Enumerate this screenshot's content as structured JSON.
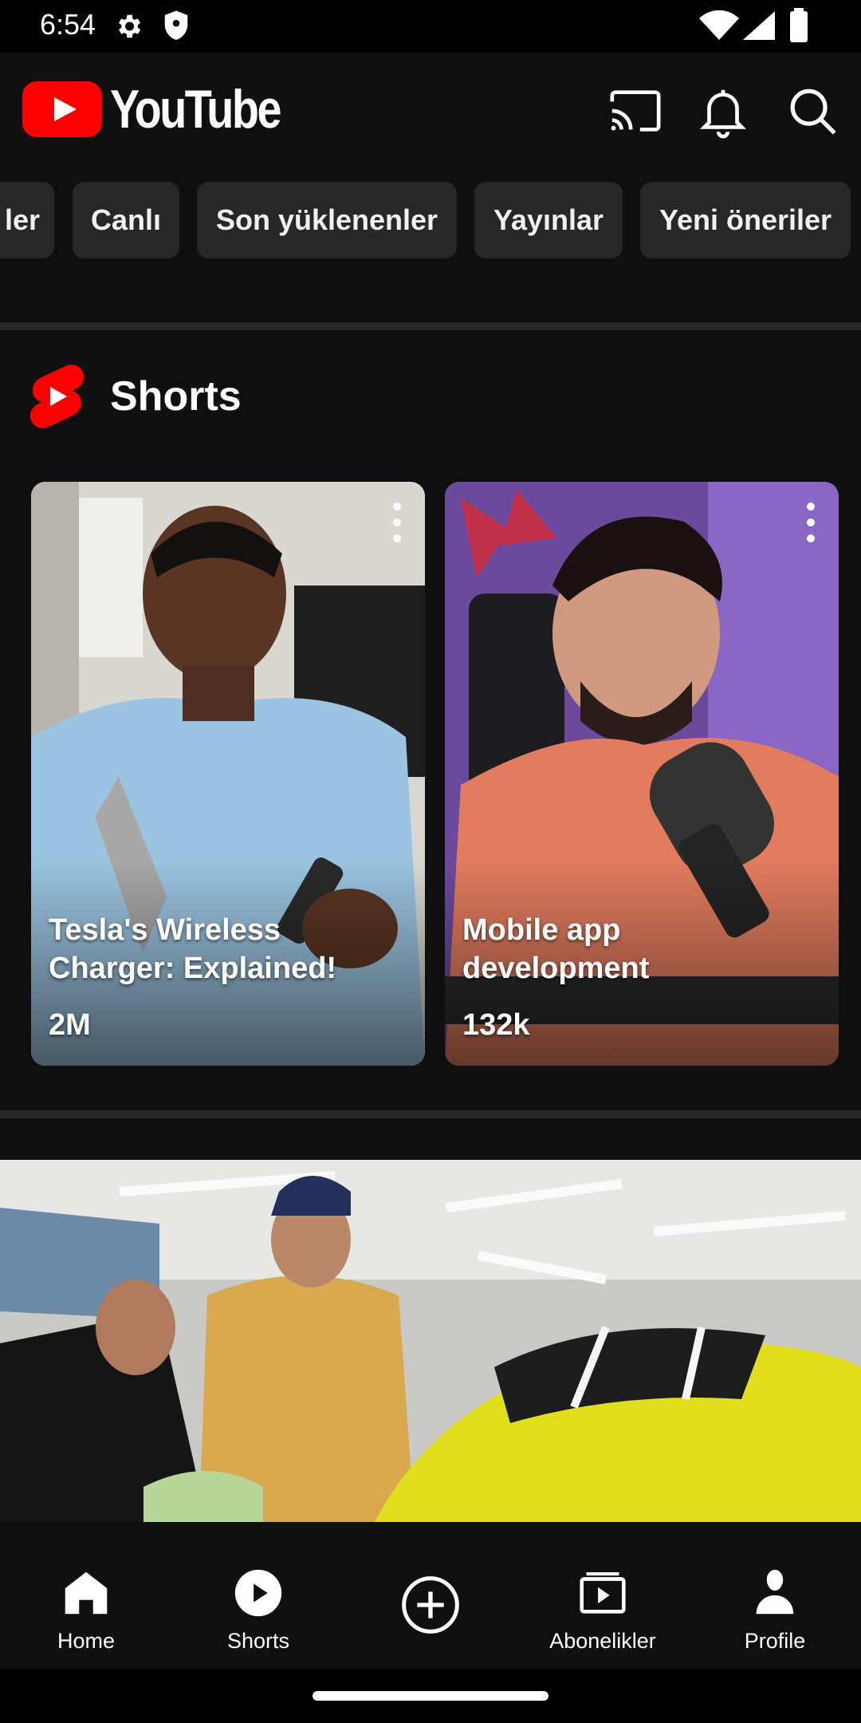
{
  "status_bar": {
    "time": "6:54"
  },
  "app_bar": {
    "logo_text": "YouTube"
  },
  "chips": [
    "ler",
    "Canlı",
    "Son yüklenenler",
    "Yayınlar",
    "Yeni öneriler"
  ],
  "shorts": {
    "title": "Shorts",
    "items": [
      {
        "title": "Tesla's Wireless Charger: Explained!",
        "views": "2M"
      },
      {
        "title": "Mobile app development",
        "views": "132k"
      }
    ]
  },
  "bottom_nav": {
    "items": [
      {
        "label": "Home"
      },
      {
        "label": "Shorts"
      },
      {
        "label": ""
      },
      {
        "label": "Abonelikler"
      },
      {
        "label": "Profile"
      }
    ]
  },
  "colors": {
    "brand_red": "#ff0000",
    "background": "#0f0f0f",
    "chip_bg": "#272727"
  }
}
